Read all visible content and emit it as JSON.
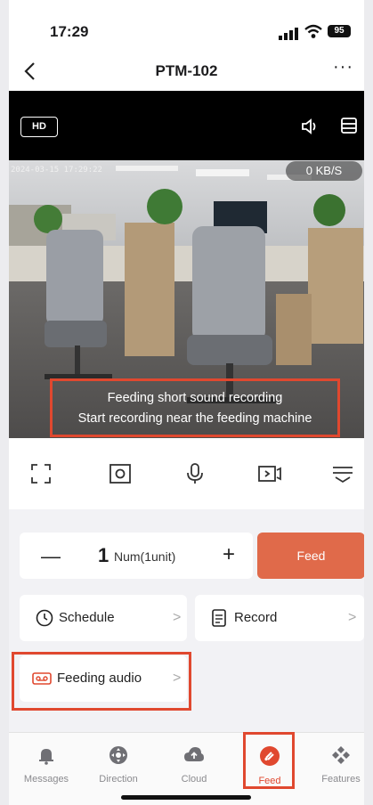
{
  "status_bar": {
    "time": "17:29",
    "battery": "95"
  },
  "nav": {
    "title": "PTM-102",
    "more": "···"
  },
  "video": {
    "hd_label": "HD",
    "timestamp": "2024-03-15 17:29:22",
    "speed": "0 KB/S",
    "caption_line1": "Feeding short sound recording",
    "caption_line2": "Start recording near the feeding machine"
  },
  "toolbar": {
    "items": [
      "fullscreen-icon",
      "screenshot-icon",
      "microphone-icon",
      "record-video-icon",
      "more-menu-icon"
    ]
  },
  "controls": {
    "quantity": "1",
    "unit_label": "Num(1unit)",
    "feed_label": "Feed",
    "schedule_label": "Schedule",
    "record_label": "Record",
    "feeding_audio_label": "Feeding audio"
  },
  "tabs": [
    {
      "label": "Messages",
      "icon": "bell-icon"
    },
    {
      "label": "Direction",
      "icon": "direction-pad-icon"
    },
    {
      "label": "Cloud",
      "icon": "cloud-upload-icon"
    },
    {
      "label": "Feed",
      "icon": "feed-icon",
      "active": true
    },
    {
      "label": "Features",
      "icon": "features-icon"
    }
  ],
  "colors": {
    "accent": "#e0482f",
    "feed_button": "#e06a4a"
  }
}
